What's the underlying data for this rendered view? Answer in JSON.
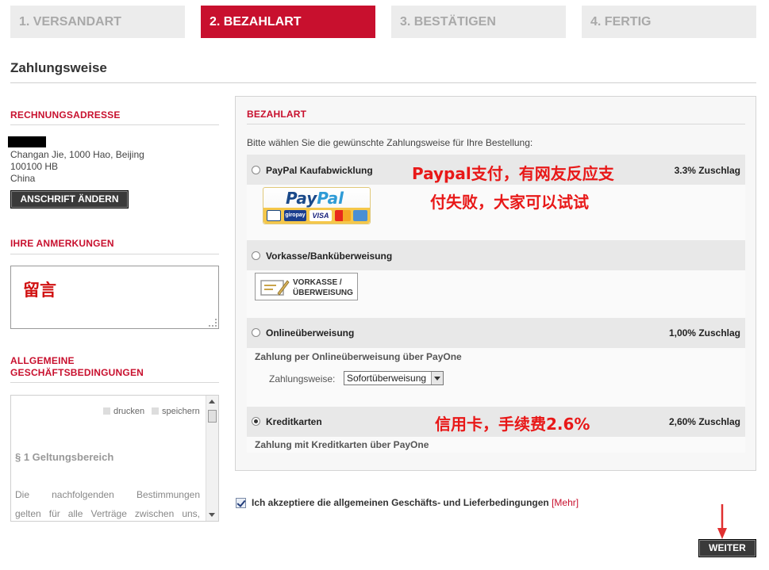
{
  "steps": [
    "1. VERSANDART",
    "2. BEZAHLART",
    "3. BESTÄTIGEN",
    "4. FERTIG"
  ],
  "page_title": "Zahlungsweise",
  "left": {
    "address_heading": "RECHNUNGSADRESSE",
    "address_lines": [
      "Changan Jie, 1000 Hao, Beijing",
      "100100 HB",
      "China"
    ],
    "change_address_button": "ANSCHRIFT ÄNDERN",
    "notes_heading": "IHRE ANMERKUNGEN",
    "notes_value": "留言",
    "terms_heading_line1": "ALLGEMEINE",
    "terms_heading_line2": "GESCHÄFTSBEDINGUNGEN",
    "terms_print": "drucken",
    "terms_save": "speichern",
    "terms_section": "§ 1 Geltungsbereich",
    "terms_text_line1": "Die nachfolgenden Bestimmungen",
    "terms_text_line2": "gelten für alle Verträge zwischen uns,"
  },
  "payment": {
    "heading": "BEZAHLART",
    "intro": "Bitte wählen Sie die gewünschte Zahlungsweise für Ihre Bestellung:",
    "options": [
      {
        "label": "PayPal Kaufabwicklung",
        "fee": "3.3% Zuschlag",
        "selected": false
      },
      {
        "label": "Vorkasse/Banküberweisung",
        "fee": "",
        "selected": false
      },
      {
        "label": "Onlineüberweisung",
        "fee": "1,00% Zuschlag",
        "selected": false
      },
      {
        "label": "Kreditkarten",
        "fee": "2,60% Zuschlag",
        "selected": true
      }
    ],
    "paypal_logo_text_a": "Pay",
    "paypal_logo_text_b": "Pal",
    "paypal_cards": [
      "giropay",
      "VISA"
    ],
    "vorkasse_logo_line1": "VORKASSE /",
    "vorkasse_logo_line2": "ÜBERWEISUNG",
    "online_desc": "Zahlung per Onlineüberweisung über PayOne",
    "online_method_label": "Zahlungsweise:",
    "online_method_value": "Sofortüberweisung",
    "credit_desc": "Zahlung mit Kreditkarten über PayOne"
  },
  "annotations": {
    "paypal_line1": "Paypal支付，有网友反应支",
    "paypal_line2": "付失败，大家可以试试",
    "credit": "信用卡，手续费2.6%"
  },
  "agree": {
    "text": "Ich akzeptiere die allgemeinen Geschäfts- und Lieferbedingungen",
    "more": "[Mehr]",
    "checked": true
  },
  "next_button": "WEITER",
  "colors": {
    "accent": "#c8102e",
    "annotation": "#e81818"
  }
}
